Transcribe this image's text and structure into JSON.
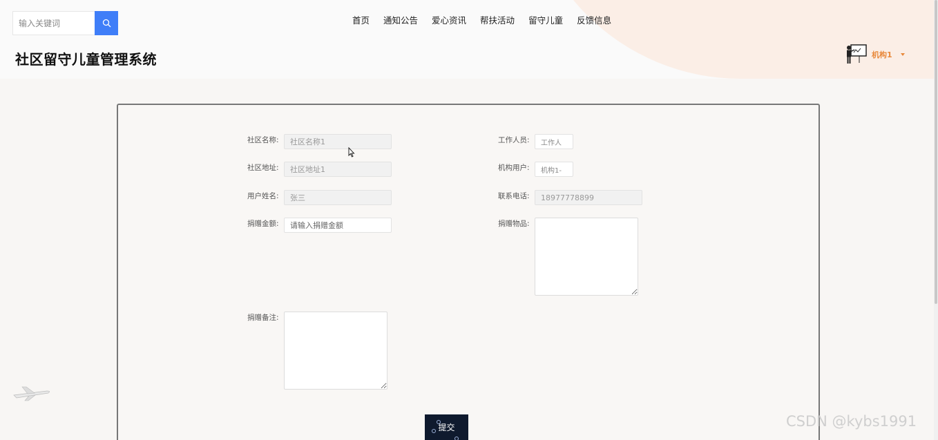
{
  "header": {
    "search": {
      "placeholder": "输入关键词"
    },
    "nav": [
      "首页",
      "通知公告",
      "爱心资讯",
      "帮扶活动",
      "留守儿童",
      "反馈信息"
    ],
    "title": "社区留守儿童管理系统",
    "user": {
      "name": "机构1"
    }
  },
  "form": {
    "left": [
      {
        "label": "社区名称:",
        "value": "社区名称1"
      },
      {
        "label": "社区地址:",
        "value": "社区地址1"
      },
      {
        "label": "用户姓名:",
        "value": "张三"
      },
      {
        "label": "捐赠金额:",
        "placeholder": "请输入捐赠金额"
      },
      {
        "label": "捐赠备注:"
      }
    ],
    "right": [
      {
        "label": "工作人员:",
        "value": "工作人"
      },
      {
        "label": "机构用户:",
        "value": "机构1-"
      },
      {
        "label": "联系电话:",
        "value": "18977778899"
      },
      {
        "label": "捐赠物品:"
      }
    ],
    "submit": "提交"
  },
  "watermark": "CSDN @kybs1991"
}
